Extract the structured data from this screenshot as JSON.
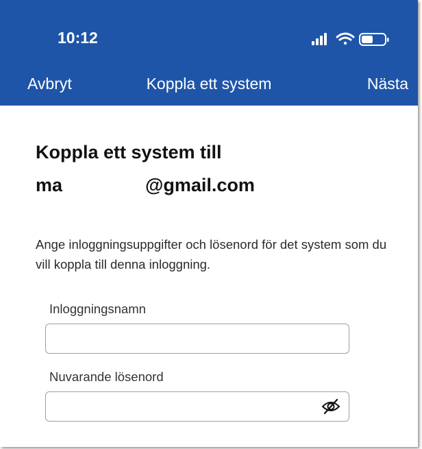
{
  "status_bar": {
    "time": "10:12"
  },
  "nav": {
    "cancel_label": "Avbryt",
    "title": "Koppla ett system",
    "next_label": "Nästa"
  },
  "heading": {
    "line1": "Koppla ett system till",
    "email_prefix": "ma",
    "email_domain": "@gmail.com"
  },
  "instructions": "Ange inloggningsuppgifter och lösenord för det system som du vill koppla till denna inloggning.",
  "fields": {
    "username": {
      "label": "Inloggningsnamn",
      "value": ""
    },
    "password": {
      "label": "Nuvarande lösenord",
      "value": ""
    }
  },
  "icons": {
    "signal": "cellular-signal-icon",
    "wifi": "wifi-icon",
    "battery": "battery-icon",
    "eye": "eye-slash-icon"
  },
  "colors": {
    "header": "#1f55a8",
    "text_on_header": "#ffffff",
    "input_border": "#9e9e9e"
  }
}
